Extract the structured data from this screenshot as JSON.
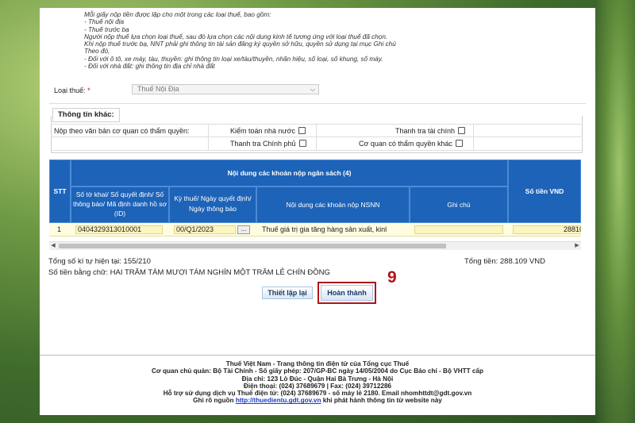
{
  "notes": [
    "Mỗi giấy nộp tiền được lập cho một trong các loại thuế, bao gồm:",
    "- Thuế nội địa",
    "- Thuế trước bạ",
    "Người nộp thuế lựa chọn loại thuế, sau đó lựa chọn các nội dung kinh tế tương ứng với loại thuế đã chọn.",
    "Khi nộp thuế trước bạ, NNT phải ghi thông tin tài sản đăng ký quyền sở hữu, quyền sử dụng tại mục Ghi chú",
    "Theo đó,",
    "- Đối với ô tô, xe máy, tàu, thuyền: ghi thông tin loại xe/tàu/thuyền, nhãn hiệu, số loại, số khung, số máy.",
    "- Đối với nhà đất: ghi thông tin địa chỉ nhà đất"
  ],
  "tax_type": {
    "label": "Loại thuế:",
    "required_mark": "*",
    "value": "Thuế Nội Địa"
  },
  "other_info": {
    "legend": "Thông tin khác:",
    "row_label": "Nộp theo văn bản cơ quan có thẩm quyền:",
    "options": [
      "Kiểm toán nhà nước",
      "Thanh tra tài chính",
      "Thanh tra Chính phủ",
      "Cơ quan có thẩm quyền khác"
    ]
  },
  "table": {
    "group_header": "Nội dung các khoản nộp ngân sách (4)",
    "col_stt": "STT",
    "col_doc": "Số tờ khai/ Số quyết định/ Số thông báo/ Mã định danh hồ sơ (ID)",
    "col_period": "Kỳ thuế/ Ngày quyết định/ Ngày thông báo",
    "col_content": "Nội dung các khoản nộp NSNN",
    "col_note": "Ghi chú",
    "col_amount": "Số tiền VND",
    "rows": [
      {
        "stt": "1",
        "doc": "0404329313010001",
        "period": "00/Q1/2023",
        "btn": "...",
        "content": "Thuế giá trị gia tăng hàng sản xuất, kinl",
        "note": "",
        "amount": "28810"
      }
    ]
  },
  "summary": {
    "char_count": "Tổng số kí tự hiện tại: 155/210",
    "total": "Tổng tiền: 288.109 VND",
    "in_words": "Số tiền bằng chữ: HAI TRĂM TÁM MƯƠI TÁM NGHÌN MỘT TRĂM LẺ CHÍN ĐỒNG"
  },
  "buttons": {
    "reset": "Thiết lập lại",
    "finish": "Hoàn thành"
  },
  "step_number": "9",
  "footer": {
    "line1": "Thuế Việt Nam - Trang thông tin điện tử của Tổng cục Thuế",
    "line2": "Cơ quan chủ quản: Bộ Tài Chính - Số giấy phép: 207/GP-BC ngày 14/05/2004 do Cục Báo chí - Bộ VHTT cấp",
    "line3": "Địa chỉ: 123 Lò Đúc - Quận Hai Bà Trưng - Hà Nội",
    "line4": "Điện thoại: (024) 37689679 | Fax: (024) 39712286",
    "line5": "Hỗ trợ sử dụng dịch vụ Thuế điện tử: (024) 37689679 - số máy lẻ 2180. Email nhomhttdt@gdt.gov.vn",
    "line6_prefix": "Ghi rõ nguồn",
    "line6_link": "http://thuedientu.gdt.gov.vn",
    "line6_suffix": "khi phát hành thông tin từ website này"
  }
}
